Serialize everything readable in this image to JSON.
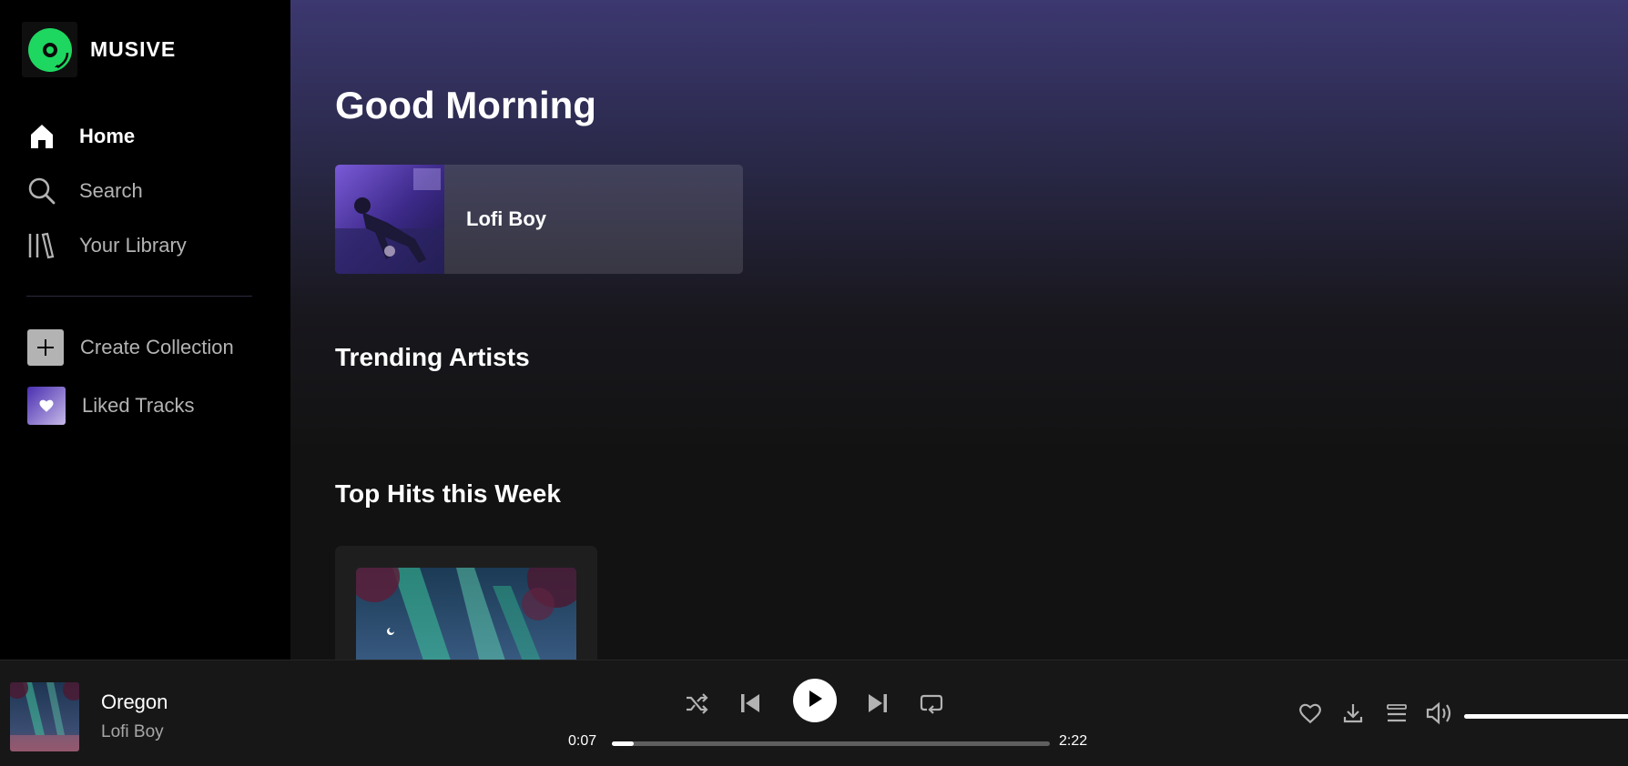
{
  "app": {
    "brand": "MUSIVE",
    "accent_color": "#1ed760"
  },
  "sidebar": {
    "nav": [
      {
        "label": "Home",
        "icon": "home-icon",
        "active": true
      },
      {
        "label": "Search",
        "icon": "search-icon",
        "active": false
      },
      {
        "label": "Your Library",
        "icon": "library-icon",
        "active": false
      }
    ],
    "collections": [
      {
        "label": "Create Collection",
        "icon": "plus-icon"
      },
      {
        "label": "Liked Tracks",
        "icon": "heart-icon"
      }
    ]
  },
  "main": {
    "greeting": "Good Morning",
    "quick_picks": [
      {
        "title": "Lofi Boy",
        "art": "anime-lofi-cover"
      }
    ],
    "sections": {
      "trending_title": "Trending Artists",
      "top_hits_title": "Top Hits this Week"
    },
    "top_hits": [
      {
        "art": "aurora-forest-cover"
      }
    ]
  },
  "player": {
    "track_title": "Oregon",
    "track_artist": "Lofi Boy",
    "current_time": "0:07",
    "total_time": "2:22",
    "progress_fraction": 0.05,
    "volume_fraction": 1.0,
    "controls": [
      "shuffle-icon",
      "previous-icon",
      "play-icon",
      "next-icon",
      "repeat-icon"
    ],
    "right_controls": [
      "heart-icon",
      "download-icon",
      "queue-icon",
      "volume-icon"
    ]
  }
}
